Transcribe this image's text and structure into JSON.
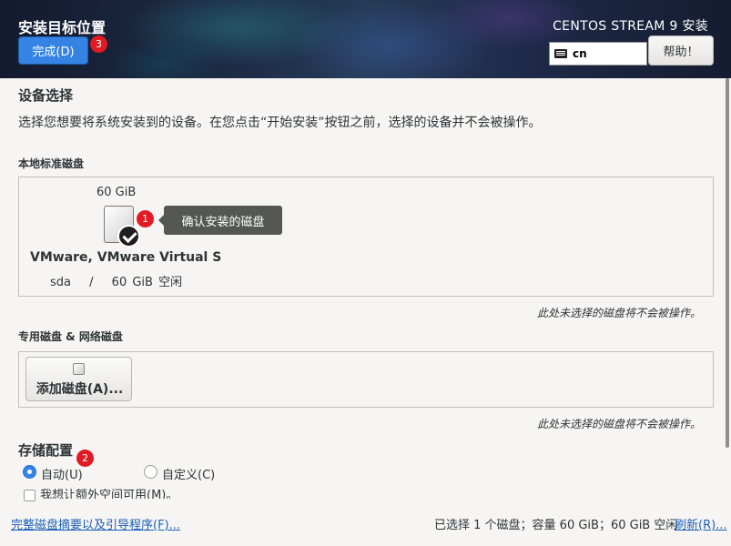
{
  "header": {
    "title": "安装目标位置",
    "done_label": "完成(D)",
    "done_badge": "3",
    "product": "CENTOS STREAM 9 安装",
    "keyboard_layout": "cn",
    "help_label": "帮助！"
  },
  "device_selection": {
    "heading": "设备选择",
    "description": "选择您想要将系统安装到的设备。在您点击“开始安装”按钮之前，选择的设备并不会被操作。"
  },
  "local_disks": {
    "heading": "本地标准磁盘",
    "disks": [
      {
        "size": "60 GiB",
        "name": "VMware, VMware Virtual S",
        "device": "sda",
        "separator": "/",
        "free": "60 GiB 空闲",
        "selected": true
      }
    ],
    "badge": "1",
    "tooltip": "确认安装的磁盘",
    "note": "此处未选择的磁盘将不会被操作。"
  },
  "special_disks": {
    "heading": "专用磁盘 & 网络磁盘",
    "add_label": "添加磁盘(A)...",
    "note": "此处未选择的磁盘将不会被操作。"
  },
  "storage_config": {
    "heading": "存储配置",
    "badge": "2",
    "options": [
      {
        "label": "自动(U)",
        "checked": true
      },
      {
        "label": "自定义(C)",
        "checked": false
      }
    ],
    "extra_space_label": "我想让额外空间可用(M)。"
  },
  "footer": {
    "summary_link": "完整磁盘摘要以及引导程序(F)...",
    "summary_text": "已选择 1 个磁盘；容量 60 GiB；60 GiB 空闲",
    "refresh_link": "刷新(R)..."
  },
  "colors": {
    "accent": "#3584e4",
    "badge": "#e01b24",
    "link": "#1a5fb4"
  }
}
